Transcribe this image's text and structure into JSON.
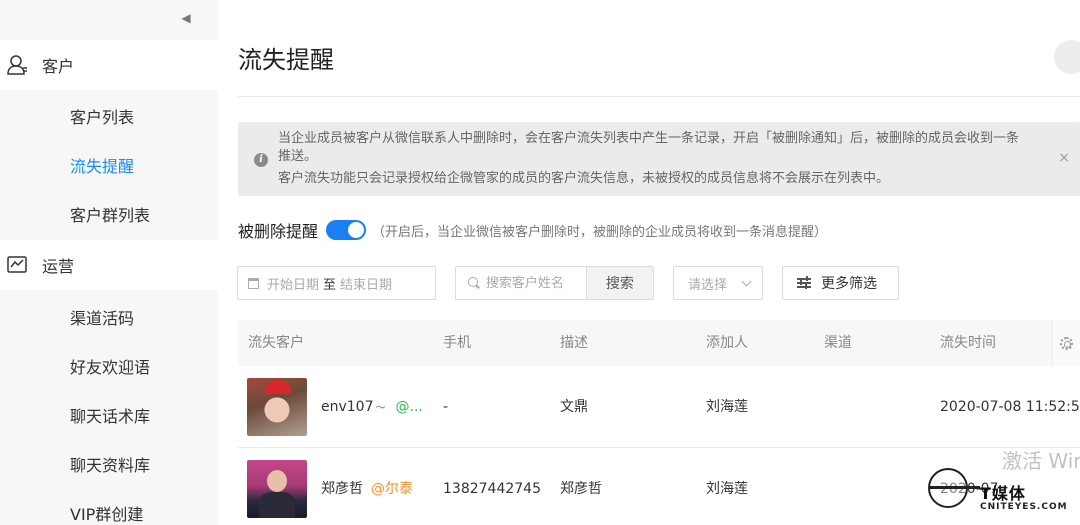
{
  "sidebar": {
    "collapse_icon": "caret-left-icon",
    "groups": [
      {
        "label": "客户",
        "icon": "customer-icon"
      },
      {
        "label": "运营",
        "icon": "chart-monitor-icon"
      }
    ],
    "customer_items": [
      "客户列表",
      "流失提醒",
      "客户群列表"
    ],
    "operation_items": [
      "渠道活码",
      "好友欢迎语",
      "聊天话术库",
      "聊天资料库",
      "VIP群创建"
    ],
    "active_item": "流失提醒",
    "active_color": "#1a8cf0"
  },
  "page": {
    "title": "流失提醒"
  },
  "notice": {
    "line1": "当企业成员被客户从微信联系人中删除时，会在客户流失列表中产生一条记录，开启「被删除通知」后，被删除的成员会收到一条",
    "line2": "推送。",
    "line3": "客户流失功能只会记录授权给企微管家的成员的客户流失信息，未被授权的成员信息将不会展示在列表中。",
    "close": "×"
  },
  "toggle": {
    "label": "被删除提醒",
    "enabled": true,
    "hint": "（开启后，当企业微信被客户删除时，被删除的企业成员将收到一条消息提醒）",
    "color": "#1a7ff0"
  },
  "filters": {
    "date_start_placeholder": "开始日期",
    "date_separator": "至",
    "date_end_placeholder": "结束日期",
    "search_placeholder": "搜索客户姓名",
    "search_button": "搜索",
    "select_placeholder": "请选择",
    "more_filters": "更多筛选"
  },
  "table": {
    "columns": [
      "流失客户",
      "手机",
      "描述",
      "添加人",
      "渠道",
      "流失时间"
    ],
    "rows": [
      {
        "name": "env107",
        "tag": "@...",
        "tag_color": "#2db84d",
        "phone": "-",
        "description": "文鼎",
        "added_by": "刘海莲",
        "channel": "",
        "lost_time": "2020-07-08 11:52:5"
      },
      {
        "name": "郑彦哲",
        "tag": "@尔泰",
        "tag_color": "#f5902b",
        "phone": "13827442745",
        "description": "郑彦哲",
        "added_by": "刘海莲",
        "channel": "",
        "lost_time": "2020-07"
      }
    ]
  },
  "watermark": {
    "activate": "激活 Win",
    "logo_cn": "T媒体",
    "logo_en": "CNITEYES.COM"
  }
}
